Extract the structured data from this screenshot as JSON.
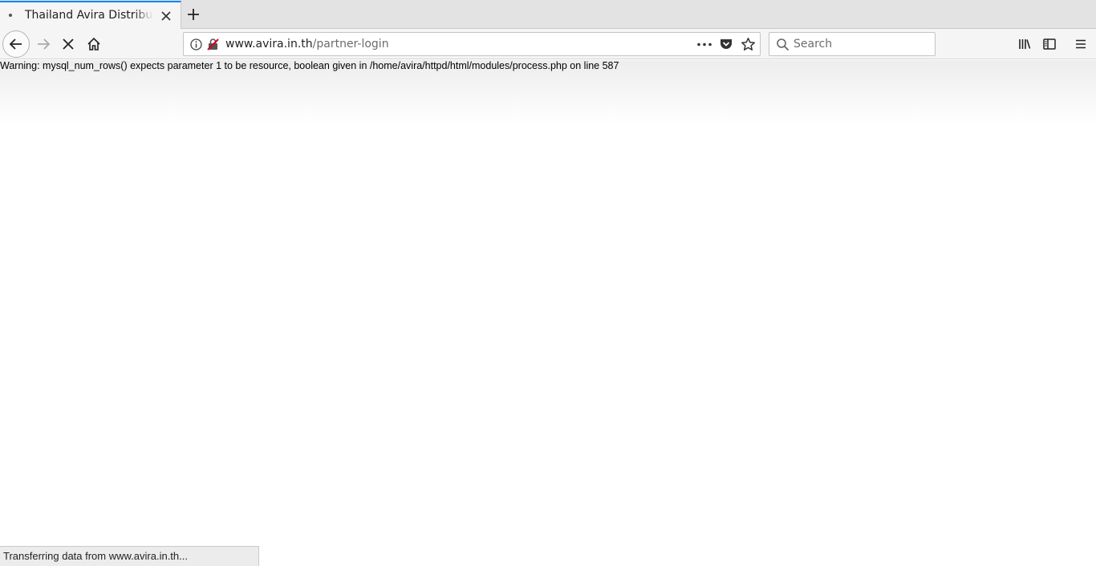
{
  "tab": {
    "title": "Thailand Avira Distributor"
  },
  "navbar": {
    "url_domain": "www.avira.in.th",
    "url_path": "/partner-login",
    "search_placeholder": "Search"
  },
  "page": {
    "warning": "Warning: mysql_num_rows() expects parameter 1 to be resource, boolean given in /home/avira/httpd/html/modules/process.php on line 587"
  },
  "status": {
    "text": "Transferring data from www.avira.in.th..."
  },
  "colors": {
    "accent": "#0a84ff",
    "toolbar": "#f5f5f5",
    "tabstrip": "#e3e3e3",
    "insecure_icon": "#d70022"
  },
  "icons": [
    "tab-loading-icon",
    "close-icon",
    "plus-icon",
    "back-arrow-icon",
    "forward-arrow-icon",
    "stop-icon",
    "home-icon",
    "info-icon",
    "insecure-lock-icon",
    "more-icon",
    "pocket-icon",
    "star-icon",
    "search-icon",
    "library-icon",
    "sidebar-icon",
    "hamburger-menu-icon"
  ]
}
